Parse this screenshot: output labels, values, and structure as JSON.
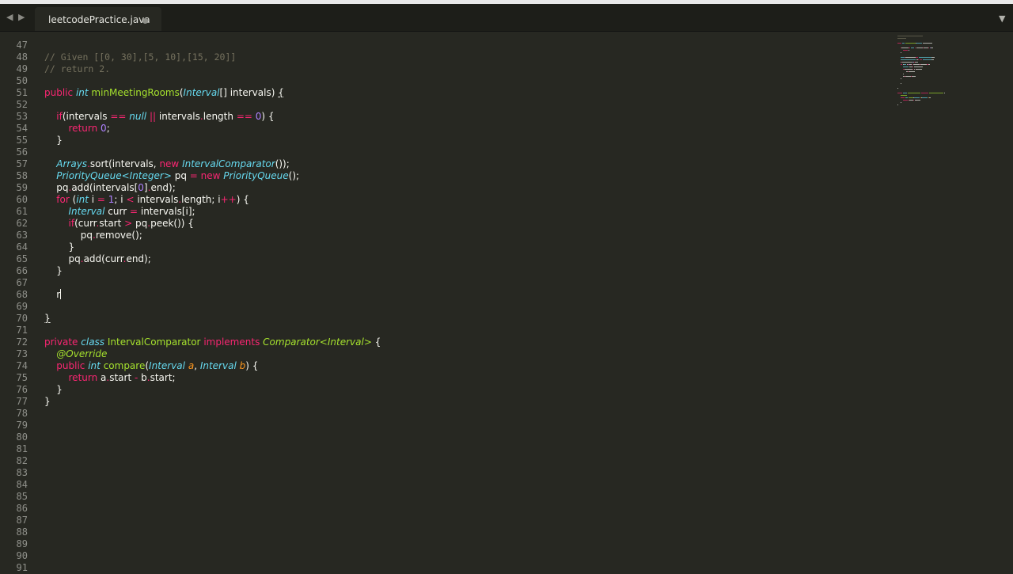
{
  "tabbar": {
    "nav_back_label": "◀",
    "nav_forward_label": "▶",
    "tab_title": "leetcodePractice.java",
    "menu_label": "▼"
  },
  "colors": {
    "background": "#272822",
    "comment": "#75715e",
    "keyword": "#f92672",
    "type": "#66d9ef",
    "function": "#a6e22e",
    "number": "#ae81ff",
    "parameter": "#fd971f",
    "gutter_text": "#8f908a",
    "text": "#f8f8f2"
  },
  "editor": {
    "first_line_number": 47,
    "cursor_line": 68,
    "lines": [
      [],
      [
        [
          "comment",
          "// Given [[0, 30],[5, 10],[15, 20]]"
        ]
      ],
      [
        [
          "comment",
          "// return 2."
        ]
      ],
      [],
      [
        [
          "keyword",
          "public"
        ],
        [
          "plain",
          " "
        ],
        [
          "storage",
          "int"
        ],
        [
          "plain",
          " "
        ],
        [
          "func",
          "minMeetingRooms"
        ],
        [
          "plain",
          "("
        ],
        [
          "type",
          "Interval"
        ],
        [
          "plain",
          "[] intervals) "
        ],
        [
          "ul",
          "{"
        ]
      ],
      [],
      [
        [
          "plain",
          "    "
        ],
        [
          "keyword",
          "if"
        ],
        [
          "plain",
          "(intervals "
        ],
        [
          "op",
          "=="
        ],
        [
          "plain",
          " "
        ],
        [
          "storage",
          "null"
        ],
        [
          "plain",
          " "
        ],
        [
          "op",
          "||"
        ],
        [
          "plain",
          " intervals"
        ],
        [
          "op",
          "."
        ],
        [
          "plain",
          "length "
        ],
        [
          "op",
          "=="
        ],
        [
          "plain",
          " "
        ],
        [
          "num",
          "0"
        ],
        [
          "plain",
          ") {"
        ]
      ],
      [
        [
          "plain",
          "        "
        ],
        [
          "keyword",
          "return"
        ],
        [
          "plain",
          " "
        ],
        [
          "num",
          "0"
        ],
        [
          "plain",
          ";"
        ]
      ],
      [
        [
          "plain",
          "    }"
        ]
      ],
      [],
      [
        [
          "plain",
          "    "
        ],
        [
          "type",
          "Arrays"
        ],
        [
          "op",
          "."
        ],
        [
          "plain",
          "sort(intervals, "
        ],
        [
          "keyword",
          "new"
        ],
        [
          "plain",
          " "
        ],
        [
          "type",
          "IntervalComparator"
        ],
        [
          "plain",
          "());"
        ]
      ],
      [
        [
          "plain",
          "    "
        ],
        [
          "type",
          "PriorityQueue<Integer>"
        ],
        [
          "plain",
          " pq "
        ],
        [
          "op",
          "="
        ],
        [
          "plain",
          " "
        ],
        [
          "keyword",
          "new"
        ],
        [
          "plain",
          " "
        ],
        [
          "type",
          "PriorityQueue"
        ],
        [
          "plain",
          "();"
        ]
      ],
      [
        [
          "plain",
          "    pq"
        ],
        [
          "op",
          "."
        ],
        [
          "plain",
          "add(intervals["
        ],
        [
          "num",
          "0"
        ],
        [
          "plain",
          "]"
        ],
        [
          "op",
          "."
        ],
        [
          "plain",
          "end);"
        ]
      ],
      [
        [
          "plain",
          "    "
        ],
        [
          "keyword",
          "for"
        ],
        [
          "plain",
          " ("
        ],
        [
          "storage",
          "int"
        ],
        [
          "plain",
          " i "
        ],
        [
          "op",
          "="
        ],
        [
          "plain",
          " "
        ],
        [
          "num",
          "1"
        ],
        [
          "plain",
          "; i "
        ],
        [
          "op",
          "<"
        ],
        [
          "plain",
          " intervals"
        ],
        [
          "op",
          "."
        ],
        [
          "plain",
          "length; i"
        ],
        [
          "op",
          "++"
        ],
        [
          "plain",
          ") {"
        ]
      ],
      [
        [
          "plain",
          "        "
        ],
        [
          "type",
          "Interval"
        ],
        [
          "plain",
          " curr "
        ],
        [
          "op",
          "="
        ],
        [
          "plain",
          " intervals[i];"
        ]
      ],
      [
        [
          "plain",
          "        "
        ],
        [
          "keyword",
          "if"
        ],
        [
          "plain",
          "(curr"
        ],
        [
          "op",
          "."
        ],
        [
          "plain",
          "start "
        ],
        [
          "op",
          ">"
        ],
        [
          "plain",
          " pq"
        ],
        [
          "op",
          "."
        ],
        [
          "plain",
          "peek()) {"
        ]
      ],
      [
        [
          "plain",
          "            pq"
        ],
        [
          "op",
          "."
        ],
        [
          "plain",
          "remove();"
        ]
      ],
      [
        [
          "plain",
          "        }"
        ]
      ],
      [
        [
          "plain",
          "        pq"
        ],
        [
          "op",
          "."
        ],
        [
          "plain",
          "add(curr"
        ],
        [
          "op",
          "."
        ],
        [
          "plain",
          "end);"
        ]
      ],
      [
        [
          "plain",
          "    }"
        ]
      ],
      [],
      [
        [
          "plain",
          "    r"
        ]
      ],
      [],
      [
        [
          "ul",
          "}"
        ]
      ],
      [],
      [
        [
          "keyword",
          "private"
        ],
        [
          "plain",
          " "
        ],
        [
          "storage",
          "class"
        ],
        [
          "plain",
          " "
        ],
        [
          "func",
          "IntervalComparator"
        ],
        [
          "plain",
          " "
        ],
        [
          "keyword",
          "implements"
        ],
        [
          "plain",
          " "
        ],
        [
          "generic",
          "Comparator<Interval>"
        ],
        [
          "plain",
          " {"
        ]
      ],
      [
        [
          "plain",
          "    "
        ],
        [
          "annot",
          "@Override"
        ]
      ],
      [
        [
          "plain",
          "    "
        ],
        [
          "keyword",
          "public"
        ],
        [
          "plain",
          " "
        ],
        [
          "storage",
          "int"
        ],
        [
          "plain",
          " "
        ],
        [
          "func",
          "compare"
        ],
        [
          "plain",
          "("
        ],
        [
          "type",
          "Interval"
        ],
        [
          "plain",
          " "
        ],
        [
          "param",
          "a"
        ],
        [
          "plain",
          ", "
        ],
        [
          "type",
          "Interval"
        ],
        [
          "plain",
          " "
        ],
        [
          "param",
          "b"
        ],
        [
          "plain",
          ") {"
        ]
      ],
      [
        [
          "plain",
          "        "
        ],
        [
          "keyword",
          "return"
        ],
        [
          "plain",
          " a"
        ],
        [
          "op",
          "."
        ],
        [
          "plain",
          "start "
        ],
        [
          "op",
          "-"
        ],
        [
          "plain",
          " b"
        ],
        [
          "op",
          "."
        ],
        [
          "plain",
          "start;"
        ]
      ],
      [
        [
          "plain",
          "    }"
        ]
      ],
      [
        [
          "plain",
          "}"
        ]
      ],
      [],
      [],
      [],
      [],
      [],
      [],
      [],
      [],
      [],
      [],
      [],
      [],
      [],
      []
    ]
  }
}
